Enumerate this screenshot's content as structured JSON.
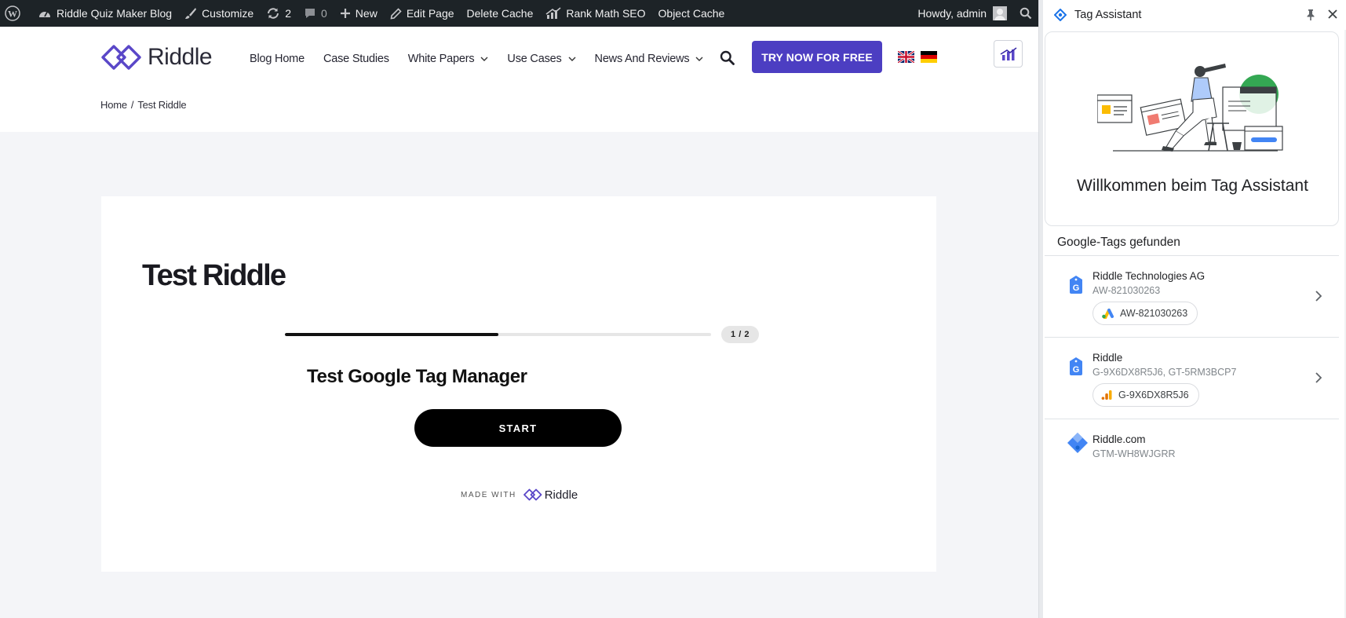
{
  "admin_bar": {
    "site_name": "Riddle Quiz Maker Blog",
    "customize": "Customize",
    "updates_count": "2",
    "comments_count": "0",
    "new_label": "New",
    "edit_page": "Edit Page",
    "delete_cache": "Delete Cache",
    "rank_math": "Rank Math SEO",
    "object_cache": "Object Cache",
    "howdy": "Howdy, admin"
  },
  "site": {
    "logo_text": "Riddle",
    "nav": [
      {
        "label": "Blog Home"
      },
      {
        "label": "Case Studies"
      },
      {
        "label": "White Papers"
      },
      {
        "label": "Use Cases"
      },
      {
        "label": "News And Reviews"
      }
    ],
    "cta": "TRY NOW FOR FREE",
    "breadcrumb": {
      "home": "Home",
      "sep": "/",
      "current": "Test Riddle"
    }
  },
  "post": {
    "title": "Test Riddle",
    "progress_fraction": 0.5,
    "step": "1 / 2",
    "quiz_title": "Test Google Tag Manager",
    "start": "START",
    "made_with": "MADE WITH",
    "made_with_brand": "Riddle"
  },
  "colors": {
    "admin_bar": "#1d2327",
    "brand_purple": "#4c3ec2",
    "page_bg": "#f4f5f8",
    "google_blue": "#4285f4"
  },
  "tag_assistant": {
    "title": "Tag Assistant",
    "welcome": "Willkommen beim Tag Assistant",
    "found_title": "Google-Tags gefunden",
    "tags": [
      {
        "name": "Riddle Technologies AG",
        "ids": "AW-821030263",
        "chip": "AW-821030263",
        "chip_icon": "google-ads-icon",
        "has_chevron": true
      },
      {
        "name": "Riddle",
        "ids": "G-9X6DX8R5J6, GT-5RM3BCP7",
        "chip": "G-9X6DX8R5J6",
        "chip_icon": "google-analytics-icon",
        "has_chevron": true
      },
      {
        "name": "Riddle.com",
        "ids": "GTM-WH8WJGRR",
        "icon": "tag-manager-icon",
        "has_chevron": false
      }
    ]
  }
}
